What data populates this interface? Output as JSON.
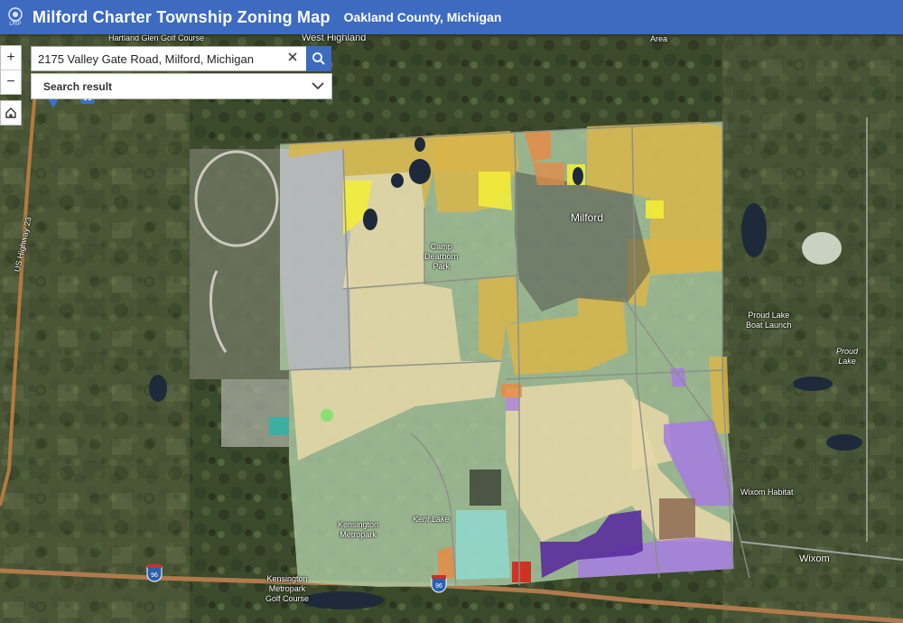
{
  "header": {
    "logo_text": "LRIP",
    "title": "Milford Charter Township Zoning Map",
    "subtitle": "Oakland County, Michigan"
  },
  "search": {
    "value": "2175 Valley Gate Road, Milford, Michigan",
    "results_label": "Search result"
  },
  "controls": {
    "zoom_in": "+",
    "zoom_out": "−"
  },
  "map_labels": {
    "west_highland": "West Highland",
    "area": "Area",
    "hartland_glen": "Hartland Glen\nGolf Course",
    "us23": "US Highway 23",
    "milford": "Milford",
    "camp_dearborn": "Camp\nDearborn\nPark",
    "proud_lake_launch": "Proud Lake\nBoat Launch",
    "proud_lake": "Proud\nLake",
    "wixom_habitat": "Wixom Habitat",
    "wixom": "Wixom",
    "kensington_metropark": "Kensington\nMetropark",
    "kent_lake": "Kent Lake",
    "kensington_golf": "Kensington\nMetropark\nGolf Course",
    "i96_a": "96",
    "i96_b": "96"
  },
  "colors": {
    "header": "#3d6bbf",
    "residential": "#e6d8a8",
    "agricultural": "#a8c7a0",
    "commercial_gold": "#d9b54a",
    "industrial_gray": "#b9b9c0",
    "yellow": "#f2ec3a",
    "purple": "#a67be0",
    "dark_purple": "#5a2d9e",
    "cyan": "#8fd9cf",
    "orange": "#e58b46",
    "red": "#d42a1e",
    "brown": "#8e6a52"
  }
}
